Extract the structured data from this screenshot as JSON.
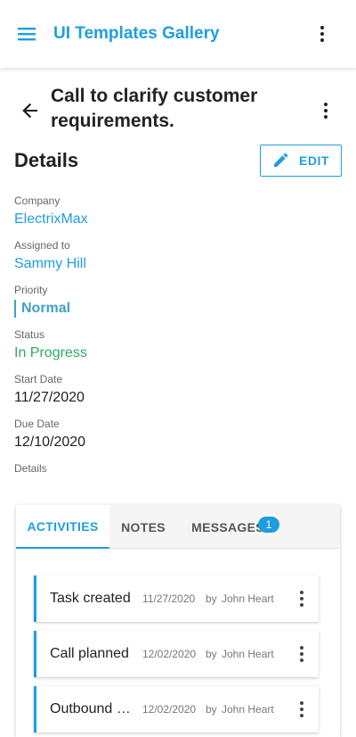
{
  "appbar": {
    "title": "UI Templates Gallery",
    "menu_icon": "menu-icon",
    "more_icon": "more-vert-icon"
  },
  "task": {
    "title": "Call to clarify customer requirements.",
    "back_icon": "arrow-back-icon"
  },
  "details": {
    "heading": "Details",
    "edit_label": "EDIT",
    "fields": {
      "company": {
        "label": "Company",
        "value": "ElectrixMax"
      },
      "assigned": {
        "label": "Assigned to",
        "value": "Sammy Hill"
      },
      "priority": {
        "label": "Priority",
        "value": "Normal"
      },
      "status": {
        "label": "Status",
        "value": "In Progress"
      },
      "start": {
        "label": "Start Date",
        "value": "11/27/2020"
      },
      "due": {
        "label": "Due Date",
        "value": "12/10/2020"
      },
      "details": {
        "label": "Details"
      }
    }
  },
  "tabs": [
    {
      "label": "ACTIVITIES",
      "active": true
    },
    {
      "label": "NOTES",
      "active": false
    },
    {
      "label": "MESSAGES",
      "active": false,
      "badge": "1"
    }
  ],
  "activities": [
    {
      "name": "Task created",
      "date": "11/27/2020",
      "by": "by",
      "user": "John Heart"
    },
    {
      "name": "Call planned",
      "date": "12/02/2020",
      "by": "by",
      "user": "John Heart"
    },
    {
      "name": "Outbound c...",
      "date": "12/02/2020",
      "by": "by",
      "user": "John Heart"
    }
  ],
  "colors": {
    "accent": "#1e9ee0",
    "priority": "#43a0c4",
    "status": "#2eaa62"
  }
}
